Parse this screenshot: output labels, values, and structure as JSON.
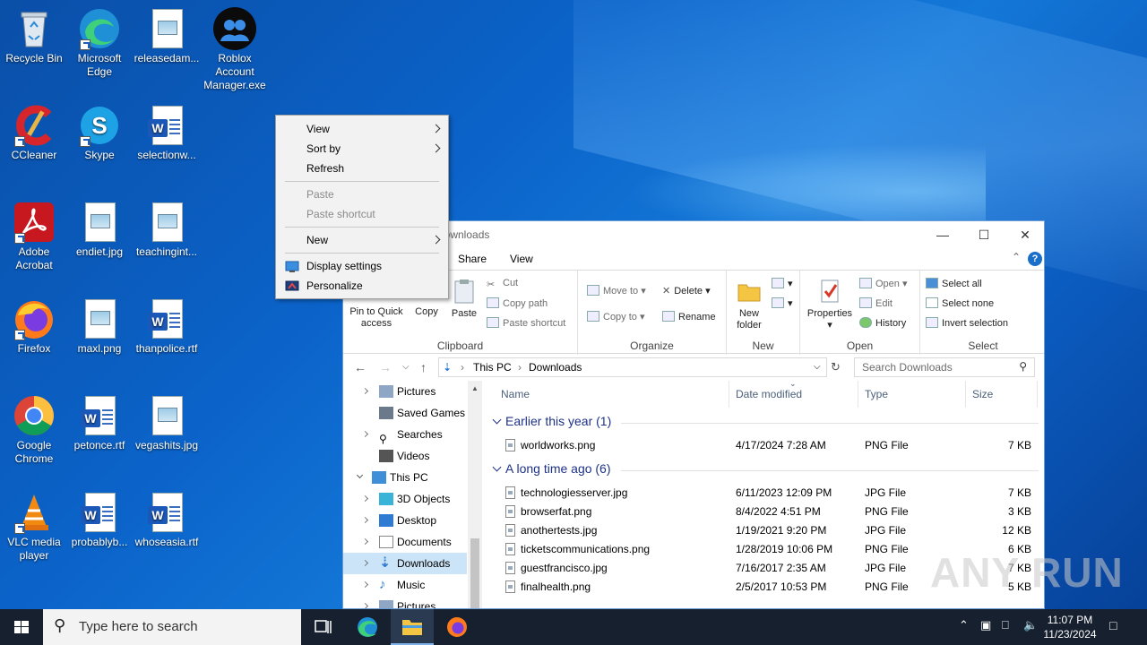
{
  "desktop": {
    "icons": [
      {
        "label": "Recycle Bin",
        "icon": "recycle-bin-icon"
      },
      {
        "label": "Microsoft Edge",
        "icon": "edge-icon"
      },
      {
        "label": "releasedam...",
        "icon": "image-file-icon"
      },
      {
        "label": "Roblox Account Manager.exe",
        "icon": "roblox-manager-icon"
      },
      {
        "label": "CCleaner",
        "icon": "ccleaner-icon"
      },
      {
        "label": "Skype",
        "icon": "skype-icon"
      },
      {
        "label": "selectionw...",
        "icon": "word-doc-icon"
      },
      {
        "label": "Adobe Acrobat",
        "icon": "acrobat-icon"
      },
      {
        "label": "endiet.jpg",
        "icon": "image-file-icon"
      },
      {
        "label": "teachingint...",
        "icon": "image-file-icon"
      },
      {
        "label": "Firefox",
        "icon": "firefox-icon"
      },
      {
        "label": "maxl.png",
        "icon": "image-file-icon"
      },
      {
        "label": "thanpolice.rtf",
        "icon": "word-doc-icon"
      },
      {
        "label": "Google Chrome",
        "icon": "chrome-icon"
      },
      {
        "label": "petonce.rtf",
        "icon": "word-doc-icon"
      },
      {
        "label": "vegashits.jpg",
        "icon": "image-file-icon"
      },
      {
        "label": "VLC media player",
        "icon": "vlc-icon"
      },
      {
        "label": "probablyb...",
        "icon": "word-doc-icon"
      },
      {
        "label": "whoseasia.rtf",
        "icon": "word-doc-icon"
      }
    ]
  },
  "context_menu": {
    "view": "View",
    "sort_by": "Sort by",
    "refresh": "Refresh",
    "paste": "Paste",
    "paste_shortcut": "Paste shortcut",
    "new": "New",
    "display_settings": "Display settings",
    "personalize": "Personalize"
  },
  "explorer": {
    "title": "Downloads",
    "tabs": {
      "share": "Share",
      "view": "View"
    },
    "ribbon": {
      "pin": "Pin to Quick access",
      "copy": "Copy",
      "paste": "Paste",
      "cut": "Cut",
      "copy_path": "Copy path",
      "paste_shortcut": "Paste shortcut",
      "clipboard": "Clipboard",
      "move_to": "Move to",
      "copy_to": "Copy to",
      "delete": "Delete",
      "rename": "Rename",
      "organize": "Organize",
      "new_folder": "New folder",
      "new": "New",
      "properties": "Properties",
      "open": "Open",
      "edit": "Edit",
      "history": "History",
      "open_group": "Open",
      "select_all": "Select all",
      "select_none": "Select none",
      "invert_selection": "Invert selection",
      "select": "Select"
    },
    "address": {
      "this_pc": "This PC",
      "downloads": "Downloads"
    },
    "search_placeholder": "Search Downloads",
    "nav": {
      "pictures": "Pictures",
      "saved_games": "Saved Games",
      "searches": "Searches",
      "videos": "Videos",
      "this_pc": "This PC",
      "objects3d": "3D Objects",
      "desktop": "Desktop",
      "documents": "Documents",
      "downloads": "Downloads",
      "music": "Music",
      "pictures2": "Pictures"
    },
    "columns": {
      "name": "Name",
      "date": "Date modified",
      "type": "Type",
      "size": "Size"
    },
    "groups": {
      "earlier": "Earlier this year (1)",
      "long_ago": "A long time ago (6)"
    },
    "files_earlier": [
      {
        "name": "worldworks.png",
        "date": "4/17/2024 7:28 AM",
        "type": "PNG File",
        "size": "7 KB"
      }
    ],
    "files_long_ago": [
      {
        "name": "technologiesserver.jpg",
        "date": "6/11/2023 12:09 PM",
        "type": "JPG File",
        "size": "7 KB"
      },
      {
        "name": "browserfat.png",
        "date": "8/4/2022 4:51 PM",
        "type": "PNG File",
        "size": "3 KB"
      },
      {
        "name": "anothertests.jpg",
        "date": "1/19/2021 9:20 PM",
        "type": "JPG File",
        "size": "12 KB"
      },
      {
        "name": "ticketscommunications.png",
        "date": "1/28/2019 10:06 PM",
        "type": "PNG File",
        "size": "6 KB"
      },
      {
        "name": "guestfrancisco.jpg",
        "date": "7/16/2017 2:35 AM",
        "type": "JPG File",
        "size": "7 KB"
      },
      {
        "name": "finalhealth.png",
        "date": "2/5/2017 10:53 PM",
        "type": "PNG File",
        "size": "5 KB"
      }
    ]
  },
  "taskbar": {
    "search_placeholder": "Type here to search",
    "time": "11:07 PM",
    "date": "11/23/2024"
  },
  "watermark": "ANY RUN"
}
